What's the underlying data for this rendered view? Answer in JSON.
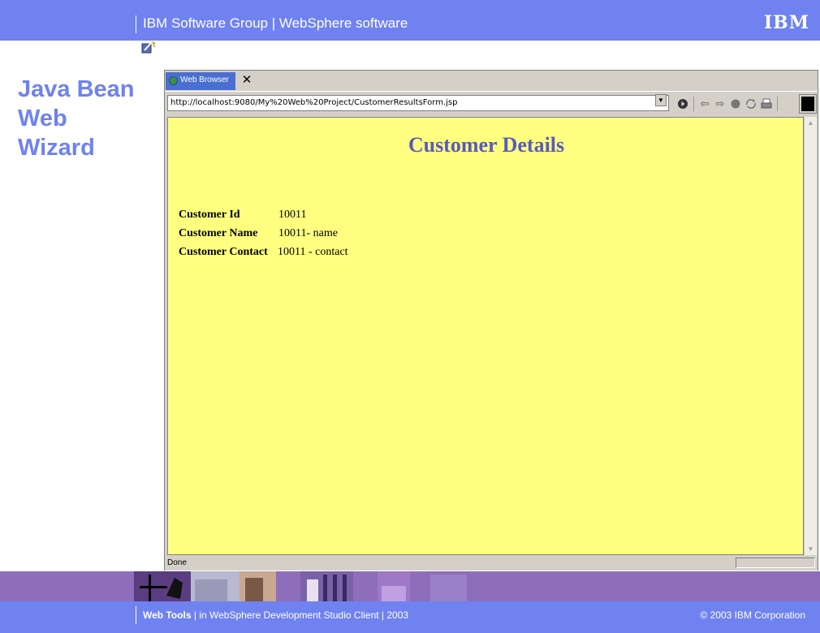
{
  "header": {
    "title": "IBM Software Group  |  WebSphere software",
    "logo_text": "IBM"
  },
  "slide": {
    "side_title_lines": [
      "Java Bean",
      "Web",
      "Wizard"
    ]
  },
  "browser": {
    "tab_label": "Web Browser",
    "tab_close": "✕",
    "url": "http://localhost:9080/My%20Web%20Project/CustomerResultsForm.jsp",
    "status_text": "Done"
  },
  "page": {
    "heading": "Customer Details",
    "fields": [
      {
        "label": "Customer Id",
        "value": "10011"
      },
      {
        "label": "Customer Name",
        "value": "10011- name"
      },
      {
        "label": "Customer Contact",
        "value": "10011 - contact"
      }
    ]
  },
  "footer": {
    "product": "Web Tools",
    "suffix": "  |  in WebSphere Development Studio Client  |  2003",
    "copyright": "© 2003 IBM Corporation"
  },
  "colors": {
    "header_blue": "#6f82f0",
    "title_blue": "#6e82f0",
    "content_yellow": "#ffff80",
    "heading_purple": "#5a5ac0",
    "footer_purple": "#8e6eba"
  },
  "icons": [
    "wizard-icon",
    "globe-icon",
    "close-icon",
    "dropdown-arrow-icon",
    "go-icon",
    "back-icon",
    "forward-icon",
    "stop-icon",
    "refresh-icon",
    "print-icon",
    "black-square-icon",
    "scroll-up-icon",
    "scroll-down-icon"
  ]
}
